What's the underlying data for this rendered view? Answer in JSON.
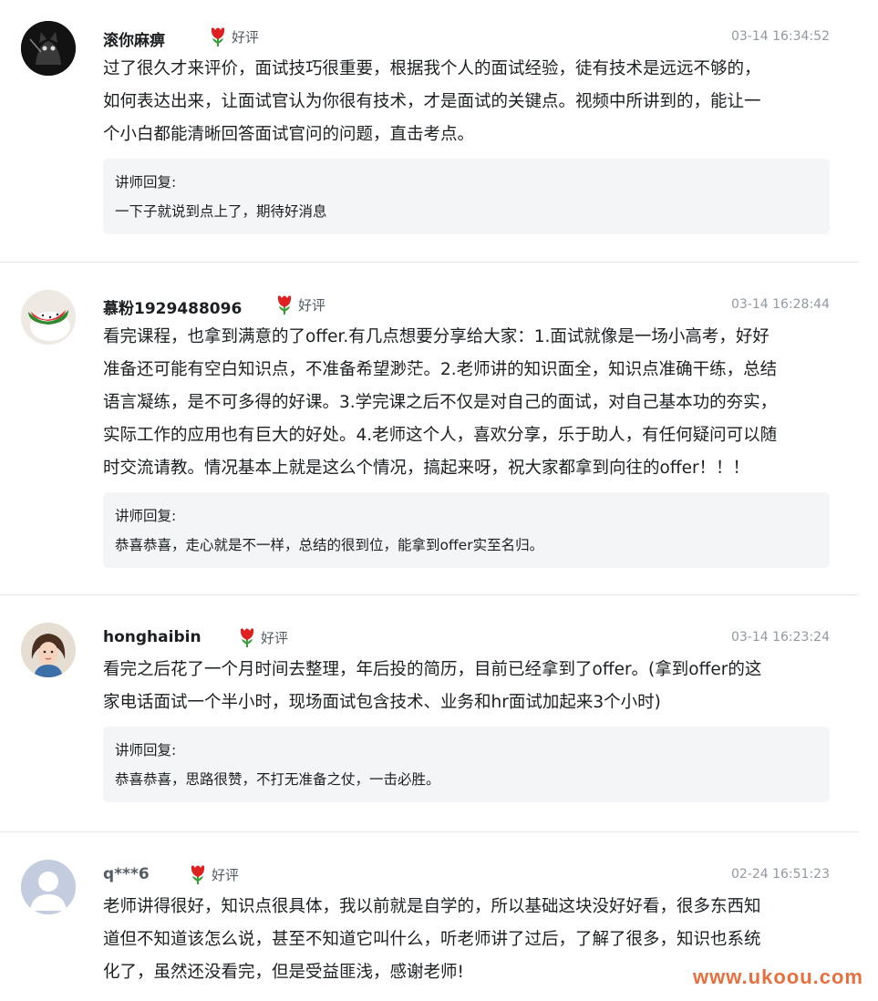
{
  "reviews": [
    {
      "avatar": "avatar-dark-cat",
      "name": "滚你麻痹",
      "badge": "好评",
      "time": "03-14 16:34:52",
      "lines": [
        "过了很久才来评价，面试技巧很重要，根据我个人的面试经验，徒有技术是远远不够的，",
        "如何表达出来，让面试官认为你很有技术，才是面试的关键点。视频中所讲到的，能让一",
        "个小白都能清晰回答面试官问的问题，直击考点。"
      ],
      "reply_label": "讲师回复:",
      "reply_text": "一下子就说到点上了，期待好消息"
    },
    {
      "avatar": "avatar-watermelon",
      "name": "慕粉1929488096",
      "badge": "好评",
      "time": "03-14 16:28:44",
      "lines": [
        "看完课程，也拿到满意的了offer.有几点想要分享给大家：1.面试就像是一场小高考，好好",
        "准备还可能有空白知识点，不准备希望渺茫。2.老师讲的知识面全，知识点准确干练，总结",
        "语言凝练，是不可多得的好课。3.学完课之后不仅是对自己的面试，对自己基本功的夯实，",
        "实际工作的应用也有巨大的好处。4.老师这个人，喜欢分享，乐于助人，有任何疑问可以随",
        "时交流请教。情况基本上就是这么个情况，搞起来呀，祝大家都拿到向往的offer！！！"
      ],
      "reply_label": "讲师回复:",
      "reply_text": "恭喜恭喜，走心就是不一样，总结的很到位，能拿到offer实至名归。"
    },
    {
      "avatar": "avatar-girl",
      "name": "honghaibin",
      "badge": "好评",
      "time": "03-14 16:23:24",
      "lines": [
        "看完之后花了一个月时间去整理，年后投的简历，目前已经拿到了offer。(拿到offer的这",
        "家电话面试一个半小时，现场面试包含技术、业务和hr面试加起来3个小时)"
      ],
      "reply_label": "讲师回复:",
      "reply_text": "恭喜恭喜，思路很赞，不打无准备之仗，一击必胜。"
    },
    {
      "avatar": "avatar-default",
      "name": "q***6",
      "badge": "好评",
      "time": "02-24 16:51:23",
      "lines": [
        "老师讲得很好，知识点很具体，我以前就是自学的，所以基础这块没好好看，很多东西知",
        "道但不知道该怎么说，甚至不知道它叫什么，听老师讲了过后，了解了很多，知识也系统",
        "化了，虽然还没看完，但是受益匪浅，感谢老师!"
      ]
    }
  ],
  "watermark": "www.ukoou.com",
  "colors": {
    "badge_icon": "#e02020",
    "watermark": "#e8703f",
    "reply_bg": "#f3f5f6"
  }
}
